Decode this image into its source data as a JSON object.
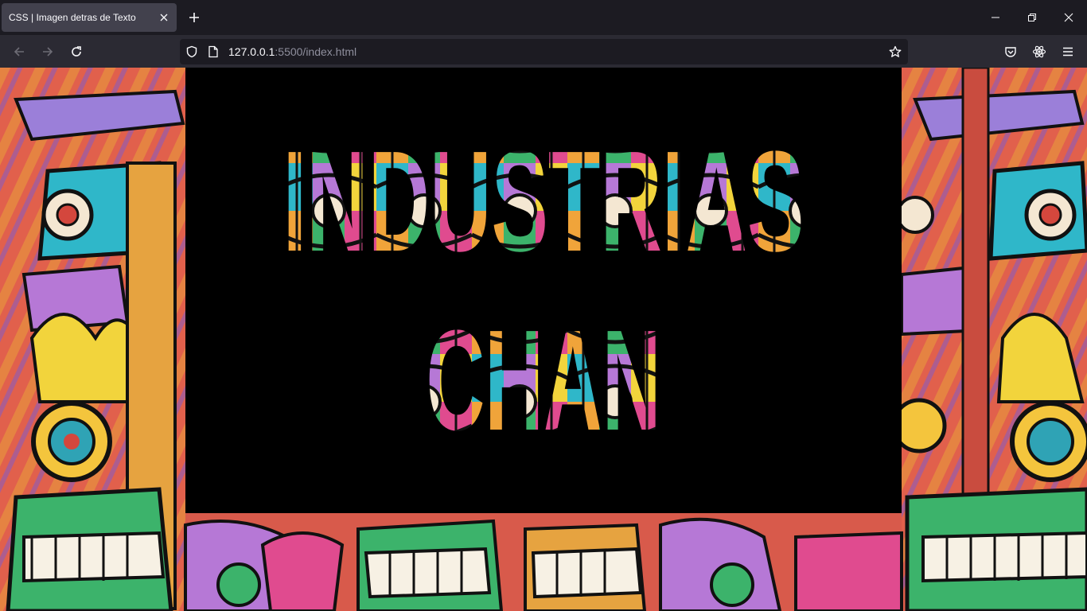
{
  "browser": {
    "tab_title": "CSS | Imagen detras de Texto",
    "url_host": "127.0.0.1",
    "url_rest": ":5500/index.html"
  },
  "page": {
    "line1": "INDUSTRIAS",
    "line2": "CHAN"
  },
  "colors": {
    "tab_bg": "#42414d",
    "navbar_bg": "#2b2a33",
    "urlbar_bg": "#1c1b22",
    "box_bg": "#000000"
  }
}
